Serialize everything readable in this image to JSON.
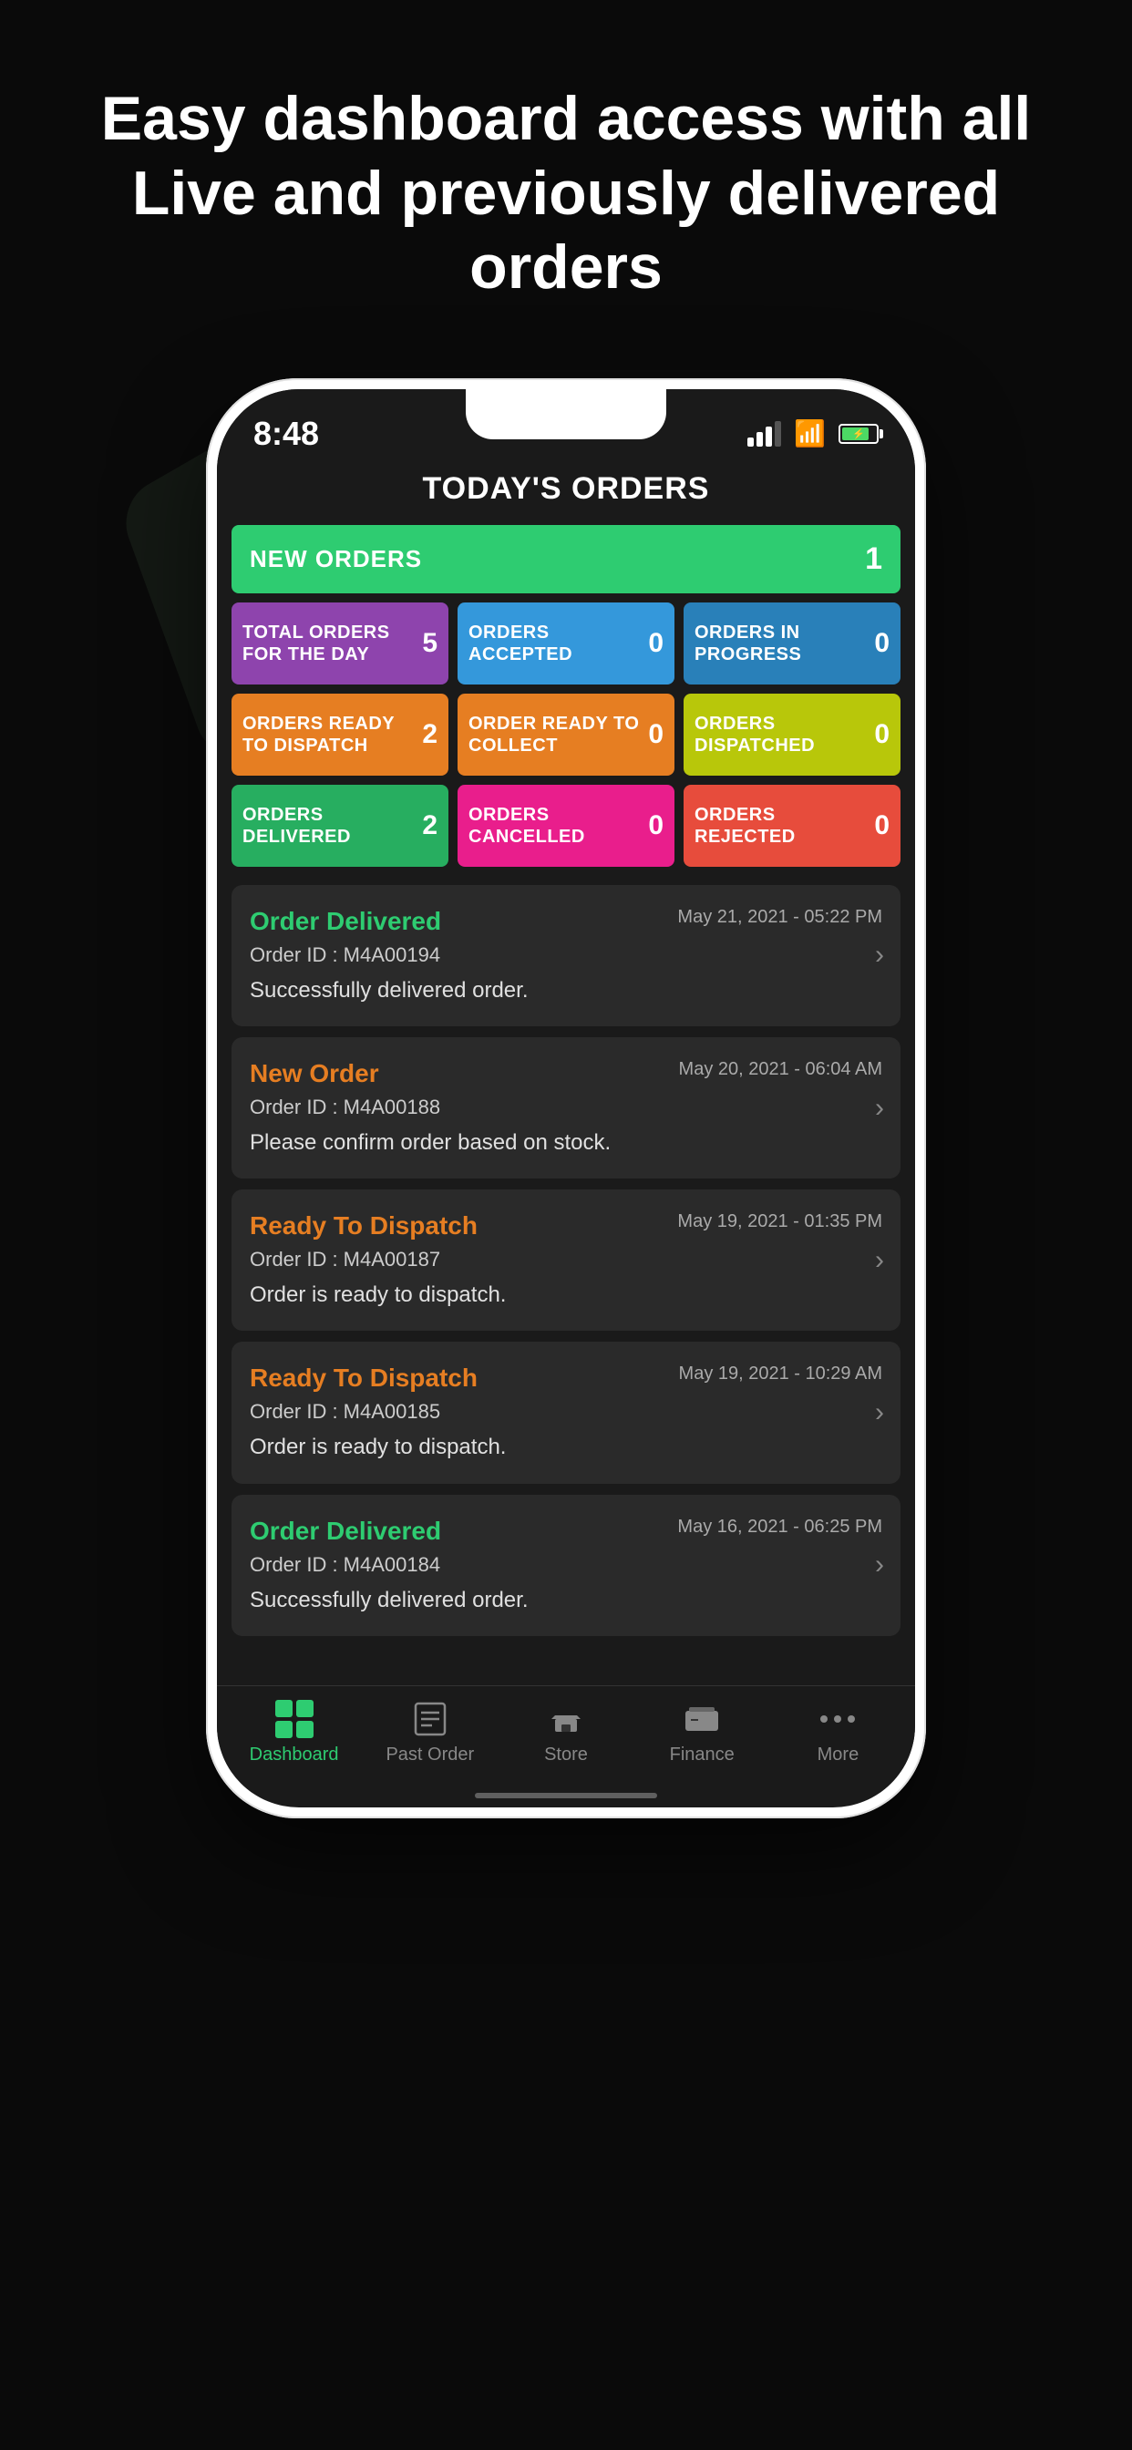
{
  "headline": "Easy dashboard access with all Live and previously delivered orders",
  "status": {
    "time": "8:48"
  },
  "header": {
    "title": "TODAY'S ORDERS"
  },
  "stats": {
    "new_orders_label": "NEW ORDERS",
    "new_orders_count": "1",
    "cards": [
      {
        "label": "TOTAL ORDERS FOR THE DAY",
        "count": "5",
        "color": "purple"
      },
      {
        "label": "ORDERS ACCEPTED",
        "count": "0",
        "color": "blue"
      },
      {
        "label": "ORDERS IN PROGRESS",
        "count": "0",
        "color": "dark-blue"
      },
      {
        "label": "ORDERS READY TO DISPATCH",
        "count": "2",
        "color": "orange"
      },
      {
        "label": "ORDER READY TO COLLECT",
        "count": "0",
        "color": "orange"
      },
      {
        "label": "ORDERS DISPATCHED",
        "count": "0",
        "color": "yellow-green"
      },
      {
        "label": "ORDERS DELIVERED",
        "count": "2",
        "color": "green"
      },
      {
        "label": "ORDERS CANCELLED",
        "count": "0",
        "color": "pink"
      },
      {
        "label": "ORDERS REJECTED",
        "count": "0",
        "color": "red"
      }
    ]
  },
  "orders": [
    {
      "status": "Order Delivered",
      "status_class": "delivered",
      "date": "May 21, 2021 - 05:22 PM",
      "id": "Order ID : M4A00194",
      "desc": "Successfully delivered order."
    },
    {
      "status": "New Order",
      "status_class": "new",
      "date": "May 20, 2021 - 06:04 AM",
      "id": "Order ID : M4A00188",
      "desc": "Please confirm order based on stock."
    },
    {
      "status": "Ready To Dispatch",
      "status_class": "dispatch",
      "date": "May 19, 2021 - 01:35 PM",
      "id": "Order ID : M4A00187",
      "desc": "Order is ready to dispatch."
    },
    {
      "status": "Ready To Dispatch",
      "status_class": "dispatch",
      "date": "May 19, 2021 - 10:29 AM",
      "id": "Order ID : M4A00185",
      "desc": "Order is ready to dispatch."
    },
    {
      "status": "Order Delivered",
      "status_class": "delivered",
      "date": "May 16, 2021 - 06:25 PM",
      "id": "Order ID : M4A00184",
      "desc": "Successfully delivered order."
    }
  ],
  "nav": {
    "items": [
      {
        "label": "Dashboard",
        "active": true
      },
      {
        "label": "Past Order",
        "active": false
      },
      {
        "label": "Store",
        "active": false
      },
      {
        "label": "Finance",
        "active": false
      },
      {
        "label": "More",
        "active": false
      }
    ]
  }
}
